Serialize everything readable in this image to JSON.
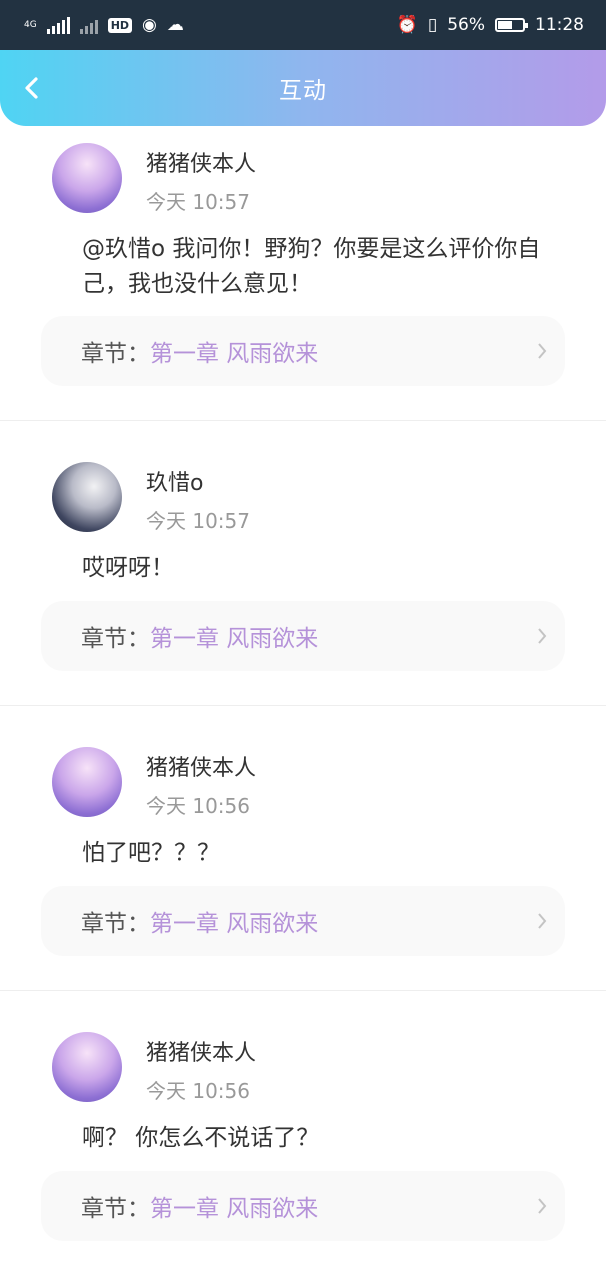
{
  "status_bar": {
    "network": "4G",
    "battery": "56%",
    "time": "11:28"
  },
  "header": {
    "title": "互动"
  },
  "chapter_label": "章节：",
  "comments": [
    {
      "user": "猪猪侠本人",
      "time": "今天 10:57",
      "text": "@玖惜o 我问你！野狗？你要是这么评价你自己，我也没什么意见！",
      "chapter": "第一章 风雨欲来"
    },
    {
      "user": "玖惜o",
      "time": "今天 10:57",
      "text": "哎呀呀！",
      "chapter": "第一章 风雨欲来"
    },
    {
      "user": "猪猪侠本人",
      "time": "今天 10:56",
      "text": "怕了吧？？？",
      "chapter": "第一章 风雨欲来"
    },
    {
      "user": "猪猪侠本人",
      "time": "今天 10:56",
      "text": "啊？ 你怎么不说话了？",
      "chapter": "第一章 风雨欲来"
    }
  ]
}
